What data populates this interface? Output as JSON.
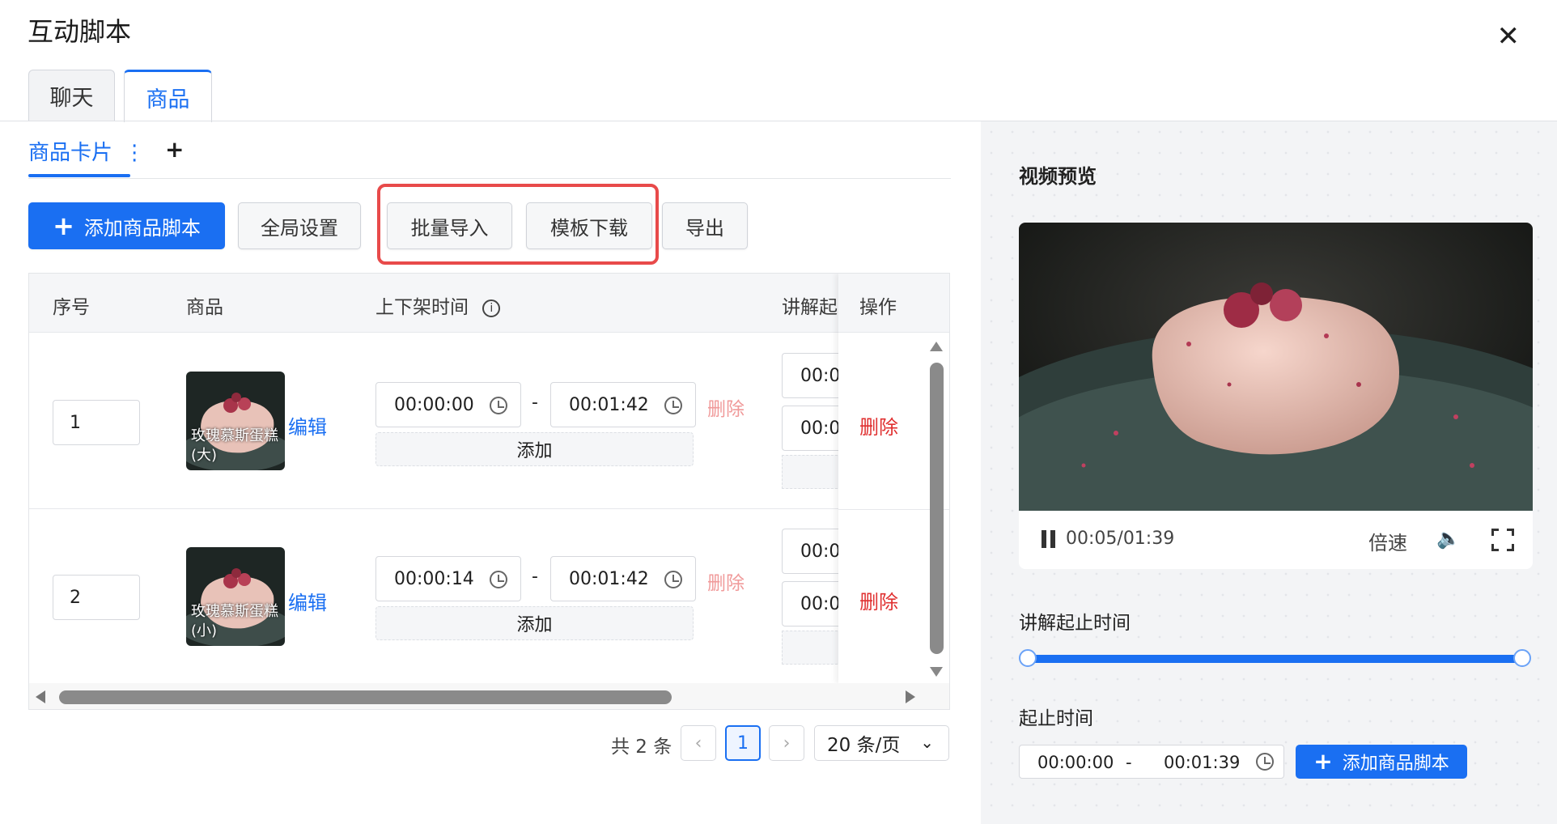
{
  "header": {
    "title": "互动脚本"
  },
  "tabs": [
    {
      "label": "聊天"
    },
    {
      "label": "商品"
    }
  ],
  "subtabs": {
    "active_label": "商品卡片",
    "more": "⋮",
    "add": "+"
  },
  "toolbar": {
    "add_label": "添加商品脚本",
    "global_label": "全局设置",
    "batch_import_label": "批量导入",
    "template_download_label": "模板下载",
    "export_label": "导出"
  },
  "table": {
    "columns": [
      "序号",
      "商品",
      "上下架时间",
      "讲解起",
      "操作"
    ],
    "rows": [
      {
        "index": "1",
        "product": "玫瑰慕斯蛋糕(大)",
        "edit": "编辑",
        "start": "00:00:00",
        "end": "00:01:42",
        "delete_time": "删除",
        "add": "添加",
        "explain_1": "00:0",
        "explain_2": "00:0",
        "delete": "删除"
      },
      {
        "index": "2",
        "product": "玫瑰慕斯蛋糕(小)",
        "edit": "编辑",
        "start": "00:00:14",
        "end": "00:01:42",
        "delete_time": "删除",
        "add": "添加",
        "explain_1": "00:0",
        "explain_2": "00:0",
        "delete": "删除"
      }
    ],
    "separator": "-"
  },
  "pagination": {
    "total": "共 2 条",
    "current": "1",
    "page_size": "20 条/页"
  },
  "preview": {
    "title": "视频预览",
    "time": "00:05/01:39",
    "speed": "倍速",
    "range_label": "讲解起止时间",
    "start_end_label": "起止时间",
    "start": "00:00:00",
    "end": "00:01:39",
    "separator": "-",
    "add_label": "添加商品脚本"
  },
  "colors": {
    "accent": "#1a6ff2",
    "danger": "#e03030",
    "highlight_box": "#e84a4a"
  }
}
